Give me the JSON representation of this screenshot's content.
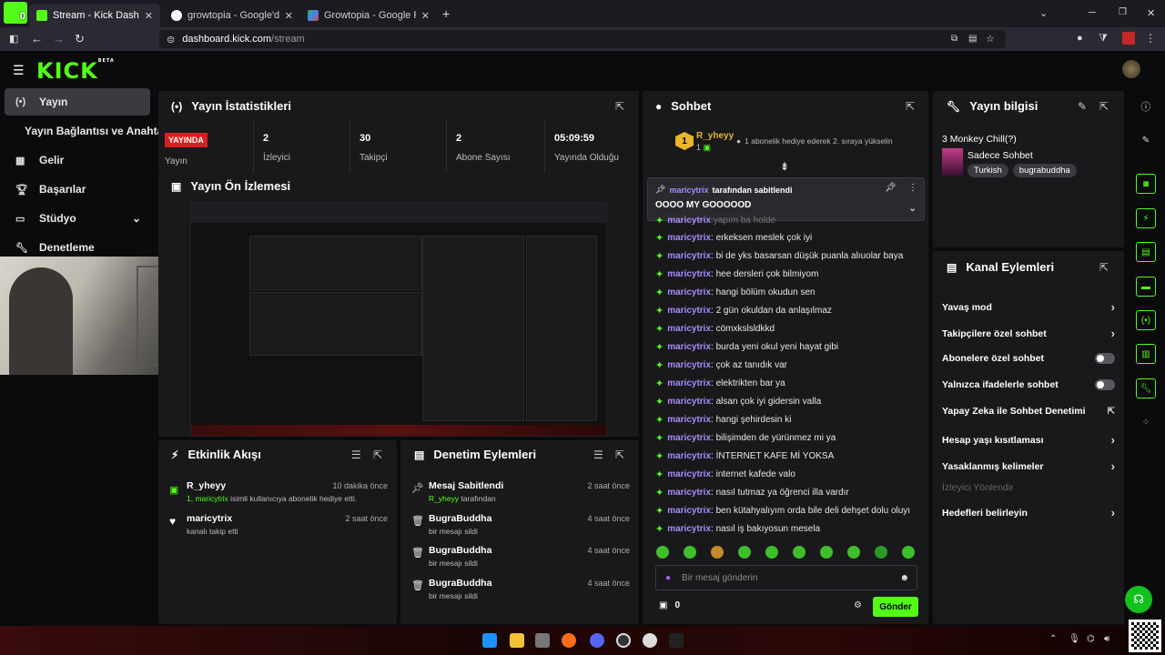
{
  "browser": {
    "corner_badge": "0",
    "tabs": [
      {
        "title": "Stream - Kick Dashboard",
        "active": true
      },
      {
        "title": "growtopia - Google'da Ara",
        "active": false
      },
      {
        "title": "Growtopia - Google Play'de Uyg",
        "active": false
      }
    ],
    "url_domain": "dashboard.kick.com",
    "url_path": "/stream",
    "new_tab": "+"
  },
  "kick": {
    "logo": "KICK",
    "logo_sup": "BETA"
  },
  "sidebar": {
    "items": [
      {
        "label": "Yayın",
        "icon": "broadcast-icon"
      },
      {
        "label": "Yayın Bağlantısı ve Anahtarı",
        "icon": ""
      },
      {
        "label": "Gelir",
        "icon": "chart-icon"
      },
      {
        "label": "Başarılar",
        "icon": "trophy-icon"
      },
      {
        "label": "Stüdyo",
        "icon": "studio-icon"
      },
      {
        "label": "Denetleme",
        "icon": "wrench-icon"
      }
    ]
  },
  "stats": {
    "title": "Yayın İstatistikleri",
    "live_badge": "YAYINDA",
    "live_label": "Yayın",
    "items": [
      {
        "value": "2",
        "label": "İzleyici"
      },
      {
        "value": "30",
        "label": "Takipçi"
      },
      {
        "value": "2",
        "label": "Abone Sayısı"
      },
      {
        "value": "05:09:59",
        "label": "Yayında Olduğu"
      }
    ]
  },
  "preview": {
    "title": "Yayın Ön İzlemesi"
  },
  "activity": {
    "title": "Etkinlik Akışı",
    "events": [
      {
        "user": "R_yheyy",
        "time": "10 dakika önce",
        "prefix": "1, maricytrix",
        "text": " isimli kullanıcıya abonelik hediye etti."
      },
      {
        "user": "maricytrix",
        "time": "2 saat önce",
        "prefix": "",
        "text": "kanalı takip etti"
      }
    ]
  },
  "moderation": {
    "title": "Denetim Eylemleri",
    "events": [
      {
        "user": "Mesaj Sabitlendi",
        "time": "2 saat önce",
        "prefix": "R_yheyy",
        "text": " tarafından"
      },
      {
        "user": "BugraBuddha",
        "time": "4 saat önce",
        "prefix": "",
        "text": "bir mesajı sildi"
      },
      {
        "user": "BugraBuddha",
        "time": "4 saat önce",
        "prefix": "",
        "text": "bir mesajı sildi"
      },
      {
        "user": "BugraBuddha",
        "time": "4 saat önce",
        "prefix": "",
        "text": "bir mesajı sildi"
      }
    ]
  },
  "chat": {
    "title": "Sohbet",
    "gifter_name": "R_yheyy",
    "gifter_rank": "1",
    "gifter_count": "1",
    "gifter_note": "1 abonelik hediye ederek 2. sıraya yükselin",
    "pinned_by": "maricytrix",
    "pinned_by_suffix": "tarafından sabitlendi",
    "pinned_message": "OOOO MY GOOOOOD",
    "partial_line": "yapım ba holde",
    "messages": [
      {
        "user": "maricytrix",
        "text": "erkeksen meslek çok iyi"
      },
      {
        "user": "maricytrix",
        "text": "bi de yks basarsan düşük puanla alıuolar baya"
      },
      {
        "user": "maricytrix",
        "text": "hee dersleri çok bilmiyom"
      },
      {
        "user": "maricytrix",
        "text": "hangi bölüm okudun sen"
      },
      {
        "user": "maricytrix",
        "text": "2 gün okuldan da anlaşılmaz"
      },
      {
        "user": "maricytrix",
        "text": "cömxkslsldkkd"
      },
      {
        "user": "maricytrix",
        "text": "burda yeni okul yeni hayat gibi"
      },
      {
        "user": "maricytrix",
        "text": "çok az tanıdık var"
      },
      {
        "user": "maricytrix",
        "text": "elektrikten bar ya"
      },
      {
        "user": "maricytrix",
        "text": "alsan çok iyi gidersin valla"
      },
      {
        "user": "maricytrix",
        "text": "hangi şehirdesin ki"
      },
      {
        "user": "maricytrix",
        "text": "bilişimden de yürünmez mi ya"
      },
      {
        "user": "maricytrix",
        "text": "İNTERNET KAFE Mİ YOKSA"
      },
      {
        "user": "maricytrix",
        "text": "internet kafede valo"
      },
      {
        "user": "maricytrix",
        "text": "nasıl tutmaz ya öğrenci illa vardır"
      },
      {
        "user": "maricytrix",
        "text": "ben kütahyalıyım orda bile deli dehşet dolu oluyı"
      },
      {
        "user": "maricytrix",
        "text": "nasıl iş bakıyosun mesela"
      }
    ],
    "input_placeholder": "Bir mesaj gönderin",
    "points": "0",
    "send_label": "Gönder"
  },
  "stream_info": {
    "title": "Yayın bilgisi",
    "stream_title": "3 Monkey Chill(?)",
    "category": "Sadece Sohbet",
    "tags": [
      "Turkish",
      "bugrabuddha"
    ]
  },
  "channel_actions": {
    "title": "Kanal Eylemleri",
    "rows": [
      {
        "label": "Yavaş mod",
        "control": "chevron"
      },
      {
        "label": "Takipçilere özel sohbet",
        "control": "chevron"
      },
      {
        "label": "Abonelere özel sohbet",
        "control": "toggle"
      },
      {
        "label": "Yalnızca ifadelerle sohbet",
        "control": "toggle"
      },
      {
        "label": "Yapay Zeka ile Sohbet Denetimi",
        "control": "external"
      },
      {
        "label": "Hesap yaşı kısıtlaması",
        "control": "chevron"
      },
      {
        "label": "Yasaklanmış kelimeler",
        "control": "chevron"
      },
      {
        "label": "İzleyici Yönlendir",
        "control": "none"
      },
      {
        "label": "Hedefleri belirleyin",
        "control": "chevron"
      }
    ]
  },
  "colors": {
    "accent": "#53fc18",
    "live": "#d81f1f",
    "username": "#a78bfa"
  }
}
